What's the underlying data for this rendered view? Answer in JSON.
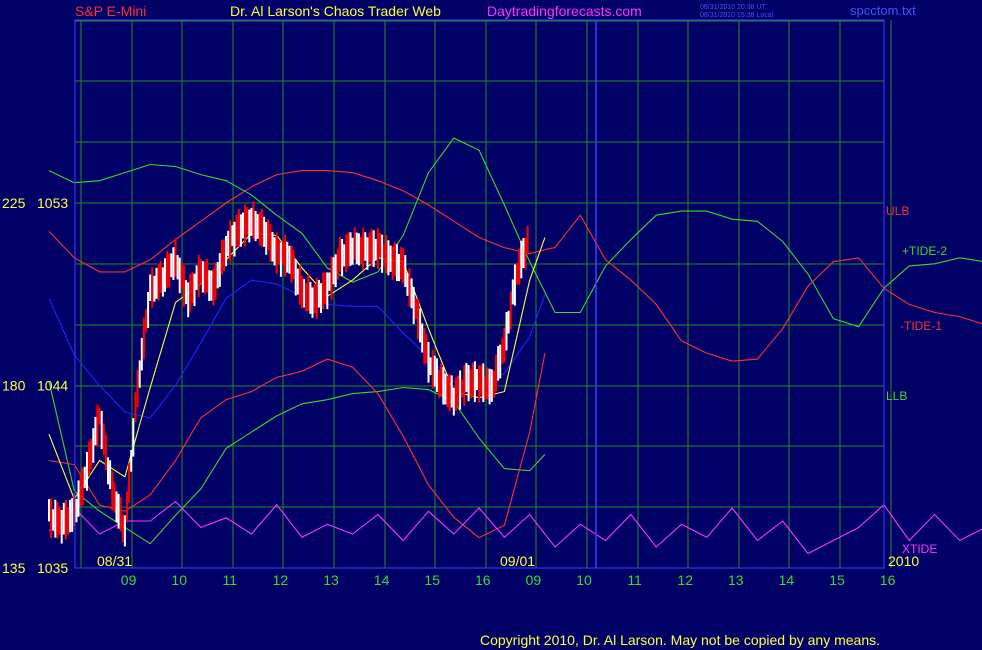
{
  "header": {
    "symbol": "S&P E-Mini",
    "title": "Dr. Al Larson's Chaos Trader Web",
    "site": "Daytradingforecasts.com",
    "timestamp_ut": "08/31/2010 20:38 UT",
    "timestamp_local": "08/31/2010 15:38 Local",
    "filename": "spcctom.txt"
  },
  "footer": {
    "copyright": "Copyright 2010, Dr. Al Larson. May not be copied by any means."
  },
  "colors": {
    "background": "#000066",
    "grid": "#228b22",
    "frame": "#3344ff",
    "price_up": "#ffffff",
    "price_down": "#ff0000",
    "ulb": "#ff3030",
    "tide2": "#33dd33",
    "tide1": "#ff3030",
    "llb": "#33dd33",
    "xtide": "#ff33ff",
    "blue_line": "#2222ff",
    "yellow_line": "#ffff44",
    "symbol_text": "#ff3030",
    "title_text": "#ffff44",
    "site_text": "#ff33ff",
    "date_text": "#ffff44",
    "hour_text": "#33dd33"
  },
  "chart_data": {
    "type": "line",
    "y_axis": {
      "ticks": [
        {
          "left": "225",
          "right": "1053",
          "value": 1053
        },
        {
          "left": "180",
          "right": "1044",
          "value": 1044
        },
        {
          "left": "135",
          "right": "1035",
          "value": 1035
        }
      ],
      "ylim": [
        1035,
        1053
      ]
    },
    "x_axis": {
      "hour_labels": [
        "09",
        "10",
        "11",
        "12",
        "13",
        "14",
        "15",
        "16",
        "09",
        "10",
        "11",
        "12",
        "13",
        "14",
        "15",
        "16"
      ],
      "date_labels": [
        "08/31",
        "09/01"
      ],
      "year_label": "2010",
      "xlim": [
        0,
        16
      ]
    },
    "legend": [
      {
        "name": "ULB",
        "color": "#ff3030"
      },
      {
        "name": "+TIDE-2",
        "color": "#33dd33"
      },
      {
        "name": "-TIDE-1",
        "color": "#ff3030"
      },
      {
        "name": "LLB",
        "color": "#33dd33"
      },
      {
        "name": "XTIDE",
        "color": "#ff33ff"
      }
    ],
    "price_series": [
      [
        0.0,
        1037.6
      ],
      [
        0.25,
        1037.2
      ],
      [
        0.5,
        1037.7
      ],
      [
        0.75,
        1039.8
      ],
      [
        1.0,
        1042.5
      ],
      [
        1.25,
        1038.8
      ],
      [
        1.5,
        1036.8
      ],
      [
        1.75,
        1043.9
      ],
      [
        2.0,
        1048.7
      ],
      [
        2.25,
        1049.3
      ],
      [
        2.5,
        1050.2
      ],
      [
        2.75,
        1048.3
      ],
      [
        3.0,
        1049.6
      ],
      [
        3.25,
        1048.8
      ],
      [
        3.5,
        1050.8
      ],
      [
        3.75,
        1051.7
      ],
      [
        4.0,
        1052.1
      ],
      [
        4.25,
        1051.6
      ],
      [
        4.5,
        1050.5
      ],
      [
        4.75,
        1050.3
      ],
      [
        5.0,
        1048.6
      ],
      [
        5.25,
        1048.2
      ],
      [
        5.5,
        1048.8
      ],
      [
        5.75,
        1050.3
      ],
      [
        6.0,
        1050.8
      ],
      [
        6.25,
        1050.7
      ],
      [
        6.5,
        1050.8
      ],
      [
        6.75,
        1050.2
      ],
      [
        7.0,
        1049.9
      ],
      [
        7.25,
        1047.7
      ],
      [
        7.5,
        1045.2
      ],
      [
        7.75,
        1044.1
      ],
      [
        8.0,
        1043.4
      ],
      [
        8.25,
        1044.2
      ],
      [
        8.5,
        1044.2
      ],
      [
        8.75,
        1043.9
      ],
      [
        9.0,
        1046.0
      ],
      [
        9.25,
        1049.6
      ],
      [
        9.5,
        1051.3
      ]
    ],
    "series": [
      {
        "name": "ULB",
        "points": [
          [
            0,
            1051.6
          ],
          [
            0.5,
            1050.3
          ],
          [
            1,
            1049.6
          ],
          [
            1.5,
            1049.6
          ],
          [
            2,
            1050.2
          ],
          [
            2.5,
            1051.2
          ],
          [
            3,
            1052.1
          ],
          [
            3.5,
            1053.0
          ],
          [
            4,
            1053.8
          ],
          [
            4.5,
            1054.4
          ],
          [
            5,
            1054.6
          ],
          [
            5.5,
            1054.6
          ],
          [
            6,
            1054.5
          ],
          [
            6.5,
            1054.1
          ],
          [
            7,
            1053.6
          ],
          [
            7.5,
            1052.9
          ],
          [
            8,
            1052.1
          ],
          [
            8.5,
            1051.3
          ],
          [
            9,
            1050.8
          ],
          [
            9.5,
            1050.5
          ],
          [
            9.8,
            1050.7
          ]
        ]
      },
      {
        "name": "+TIDE-2",
        "points": [
          [
            0,
            1054.6
          ],
          [
            0.5,
            1054.0
          ],
          [
            1,
            1054.1
          ],
          [
            1.5,
            1054.5
          ],
          [
            2,
            1054.9
          ],
          [
            2.5,
            1054.8
          ],
          [
            3,
            1054.4
          ],
          [
            3.5,
            1054.1
          ],
          [
            4,
            1053.4
          ],
          [
            4.5,
            1052.4
          ],
          [
            5,
            1051.5
          ],
          [
            5.5,
            1049.8
          ],
          [
            6,
            1049.1
          ],
          [
            6.5,
            1049.6
          ],
          [
            7,
            1051.4
          ],
          [
            7.5,
            1054.5
          ],
          [
            8,
            1056.2
          ],
          [
            8.5,
            1055.6
          ],
          [
            9,
            1052.9
          ],
          [
            9.5,
            1050.1
          ],
          [
            10,
            1047.6
          ],
          [
            10.5,
            1047.6
          ],
          [
            11,
            1049.9
          ],
          [
            11.5,
            1051.2
          ],
          [
            12,
            1052.4
          ],
          [
            12.5,
            1052.6
          ],
          [
            13,
            1052.6
          ],
          [
            13.5,
            1052.2
          ],
          [
            14,
            1052.1
          ],
          [
            14.5,
            1051.1
          ],
          [
            15,
            1049.5
          ],
          [
            15.5,
            1047.3
          ],
          [
            16,
            1046.9
          ],
          [
            16.5,
            1048.8
          ],
          [
            17,
            1049.9
          ],
          [
            17.5,
            1050.0
          ],
          [
            18,
            1050.3
          ],
          [
            18.5,
            1050.1
          ]
        ]
      },
      {
        "name": "-TIDE-1",
        "points": [
          [
            9.8,
            1050.7
          ],
          [
            10,
            1050.8
          ],
          [
            10.5,
            1052.4
          ],
          [
            11,
            1050.2
          ],
          [
            11.5,
            1049.2
          ],
          [
            12,
            1048.0
          ],
          [
            12.5,
            1046.2
          ],
          [
            13,
            1045.6
          ],
          [
            13.5,
            1045.2
          ],
          [
            14,
            1045.3
          ],
          [
            14.5,
            1046.8
          ],
          [
            15,
            1048.9
          ],
          [
            15.5,
            1050.1
          ],
          [
            16,
            1050.3
          ],
          [
            16.5,
            1048.8
          ],
          [
            17,
            1048.0
          ],
          [
            17.5,
            1047.6
          ],
          [
            18,
            1047.4
          ],
          [
            18.5,
            1047.0
          ]
        ]
      },
      {
        "name": "LLB",
        "points": [
          [
            0,
            1044.2
          ],
          [
            0.5,
            1038.8
          ],
          [
            1,
            1037.8
          ],
          [
            1.5,
            1037.0
          ],
          [
            2,
            1036.2
          ],
          [
            2.5,
            1037.6
          ],
          [
            3,
            1038.9
          ],
          [
            3.5,
            1040.9
          ],
          [
            4,
            1041.7
          ],
          [
            4.5,
            1042.5
          ],
          [
            5,
            1043.1
          ],
          [
            5.5,
            1043.3
          ],
          [
            6,
            1043.6
          ],
          [
            6.5,
            1043.7
          ],
          [
            7,
            1043.9
          ],
          [
            7.5,
            1043.8
          ],
          [
            8,
            1043.2
          ],
          [
            8.5,
            1041.4
          ],
          [
            9,
            1039.9
          ],
          [
            9.5,
            1039.8
          ],
          [
            9.8,
            1040.6
          ]
        ]
      },
      {
        "name": "-TIDE-1 (d1)",
        "points": [
          [
            0,
            1040.3
          ],
          [
            0.5,
            1040.1
          ],
          [
            1,
            1038.1
          ],
          [
            1.5,
            1037.8
          ],
          [
            2,
            1038.6
          ],
          [
            2.5,
            1040.3
          ],
          [
            3,
            1042.4
          ],
          [
            3.5,
            1043.3
          ],
          [
            4,
            1043.7
          ],
          [
            4.5,
            1044.4
          ],
          [
            5,
            1044.7
          ],
          [
            5.5,
            1045.3
          ],
          [
            6,
            1044.9
          ],
          [
            6.5,
            1043.6
          ],
          [
            7,
            1041.5
          ],
          [
            7.5,
            1039.1
          ],
          [
            8,
            1037.5
          ],
          [
            8.5,
            1036.5
          ],
          [
            9,
            1037.1
          ],
          [
            9.5,
            1041.7
          ],
          [
            9.8,
            1045.6
          ]
        ]
      },
      {
        "name": "blue",
        "points": [
          [
            0,
            1048.3
          ],
          [
            0.5,
            1045.5
          ],
          [
            1,
            1044.0
          ],
          [
            1.5,
            1042.7
          ],
          [
            2,
            1042.4
          ],
          [
            2.5,
            1044.0
          ],
          [
            3,
            1046.1
          ],
          [
            3.5,
            1048.3
          ],
          [
            4,
            1049.2
          ],
          [
            4.5,
            1049.0
          ],
          [
            5,
            1048.4
          ],
          [
            5.5,
            1048.0
          ],
          [
            6,
            1047.9
          ],
          [
            6.5,
            1047.9
          ],
          [
            7,
            1046.6
          ],
          [
            7.5,
            1045.4
          ],
          [
            8,
            1044.2
          ],
          [
            8.5,
            1043.9
          ],
          [
            9,
            1044.6
          ],
          [
            9.5,
            1046.4
          ],
          [
            9.8,
            1048.5
          ]
        ]
      },
      {
        "name": "yellow",
        "points": [
          [
            0,
            1041.6
          ],
          [
            0.5,
            1038.4
          ],
          [
            1,
            1040.3
          ],
          [
            1.5,
            1039.5
          ],
          [
            2,
            1043.9
          ],
          [
            2.5,
            1048.1
          ],
          [
            3,
            1049.0
          ],
          [
            3.5,
            1050.2
          ],
          [
            4,
            1051.5
          ],
          [
            4.5,
            1051.4
          ],
          [
            5,
            1049.8
          ],
          [
            5.5,
            1048.4
          ],
          [
            6,
            1049.2
          ],
          [
            6.5,
            1050.3
          ],
          [
            7,
            1050.1
          ],
          [
            7.5,
            1046.8
          ],
          [
            8,
            1043.7
          ],
          [
            8.5,
            1043.4
          ],
          [
            9,
            1043.7
          ],
          [
            9.5,
            1049.2
          ],
          [
            9.8,
            1051.3
          ]
        ]
      }
    ],
    "xtide": [
      [
        0,
        0.45
      ],
      [
        0.5,
        0.8
      ],
      [
        1,
        0.4
      ],
      [
        1.5,
        0.6
      ],
      [
        2,
        0.6
      ],
      [
        2.5,
        0.9
      ],
      [
        3,
        0.5
      ],
      [
        3.5,
        0.65
      ],
      [
        4,
        0.4
      ],
      [
        4.5,
        0.85
      ],
      [
        5,
        0.35
      ],
      [
        5.5,
        0.55
      ],
      [
        6,
        0.4
      ],
      [
        6.5,
        0.7
      ],
      [
        7,
        0.3
      ],
      [
        7.5,
        0.75
      ],
      [
        8,
        0.4
      ],
      [
        8.5,
        0.8
      ],
      [
        9,
        0.35
      ],
      [
        9.5,
        0.7
      ],
      [
        10,
        0.2
      ],
      [
        10.5,
        0.55
      ],
      [
        11,
        0.3
      ],
      [
        11.5,
        0.7
      ],
      [
        12,
        0.2
      ],
      [
        12.5,
        0.55
      ],
      [
        13,
        0.35
      ],
      [
        13.5,
        0.8
      ],
      [
        14,
        0.3
      ],
      [
        14.5,
        0.6
      ],
      [
        15,
        0.1
      ],
      [
        15.5,
        0.3
      ],
      [
        16,
        0.5
      ],
      [
        16.5,
        0.85
      ],
      [
        17,
        0.3
      ],
      [
        17.5,
        0.7
      ],
      [
        18,
        0.3
      ],
      [
        18.5,
        0.5
      ]
    ],
    "grid": true
  }
}
